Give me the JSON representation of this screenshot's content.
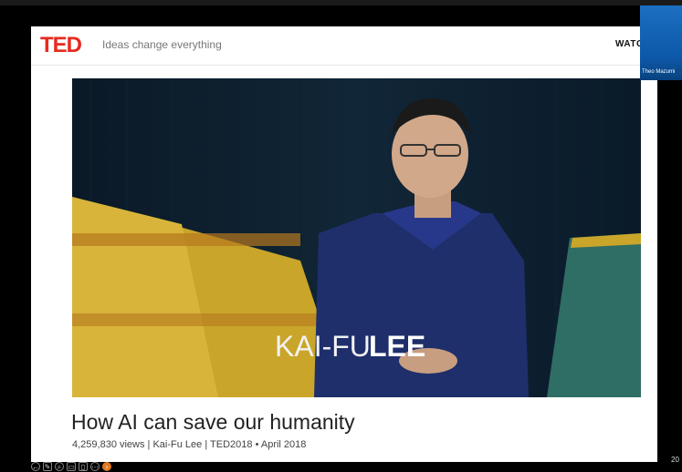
{
  "slide": {
    "logo": "TED",
    "tagline": "Ideas change everything",
    "nav_watch": "WATC",
    "video": {
      "overlay_first": "KAI-FU",
      "overlay_last": "LEE"
    },
    "talk_title": "How AI can save our humanity",
    "talk_meta": "4,259,830 views | Kai-Fu Lee | TED2018 • April 2018"
  },
  "participant": {
    "name": "Theo Mazumi"
  },
  "page_number": "20",
  "toolbar": {
    "icons": [
      "back-icon",
      "pen-icon",
      "zoom-icon",
      "captions-icon",
      "slides-icon",
      "more-icon",
      "next-icon"
    ]
  },
  "colors": {
    "ted_red": "#e62b1e",
    "accent_orange": "#e07820"
  }
}
